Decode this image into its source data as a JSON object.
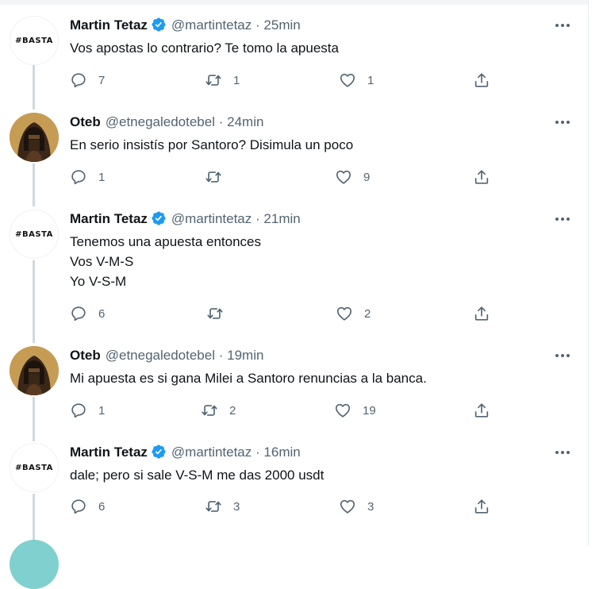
{
  "colors": {
    "verified": "#1d9bf0",
    "secondary": "#536471",
    "thread_line": "#cfd9de"
  },
  "tweets": [
    {
      "name": "Martin Tetaz",
      "handle": "@martintetaz",
      "separator": "·",
      "time": "25min",
      "verified": true,
      "avatar": "basta",
      "avatar_text": "#BASTA",
      "lines": [
        "Vos apostas lo contrario? Te tomo la apuesta"
      ],
      "replies": "7",
      "retweets": "1",
      "likes": "1"
    },
    {
      "name": "Oteb",
      "handle": "@etnegaledotebel",
      "separator": "·",
      "time": "24min",
      "verified": false,
      "avatar": "oteb",
      "lines": [
        "En serio insistís por Santoro? Disimula un poco"
      ],
      "replies": "1",
      "retweets": "",
      "likes": "9"
    },
    {
      "name": "Martin Tetaz",
      "handle": "@martintetaz",
      "separator": "·",
      "time": "21min",
      "verified": true,
      "avatar": "basta",
      "avatar_text": "#BASTA",
      "lines": [
        "Tenemos una apuesta entonces",
        "Vos V-M-S",
        "Yo V-S-M"
      ],
      "replies": "6",
      "retweets": "",
      "likes": "2"
    },
    {
      "name": "Oteb",
      "handle": "@etnegaledotebel",
      "separator": "·",
      "time": "19min",
      "verified": false,
      "avatar": "oteb",
      "lines": [
        "Mi apuesta es si gana Milei a Santoro renuncias a la banca."
      ],
      "replies": "1",
      "retweets": "2",
      "likes": "19"
    },
    {
      "name": "Martin Tetaz",
      "handle": "@martintetaz",
      "separator": "·",
      "time": "16min",
      "verified": true,
      "avatar": "basta",
      "avatar_text": "#BASTA",
      "lines": [
        "dale; pero si sale V-S-M me das 2000 usdt"
      ],
      "replies": "6",
      "retweets": "3",
      "likes": "3"
    }
  ]
}
